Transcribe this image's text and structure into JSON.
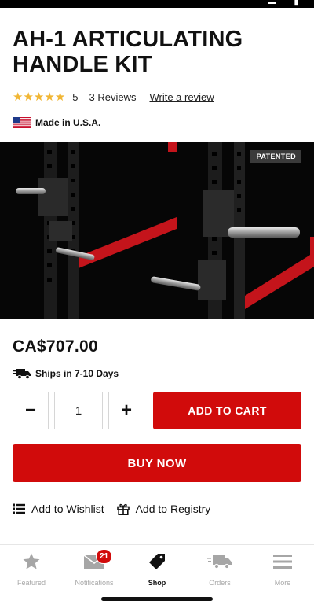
{
  "product": {
    "title": "AH-1 ARTICULATING HANDLE KIT",
    "rating_value": "5",
    "reviews_label": "3 Reviews",
    "write_review_label": "Write a review",
    "origin_label": "Made in U.S.A.",
    "badge_label": "PATENTED",
    "price": "CA$707.00",
    "shipping_label": "Ships in 7-10 Days",
    "quantity": "1",
    "minus_label": "−",
    "plus_label": "+",
    "add_to_cart_label": "ADD TO CART",
    "buy_now_label": "BUY NOW",
    "wishlist_label": "Add to Wishlist",
    "registry_label": "Add to Registry",
    "stars": 5
  },
  "colors": {
    "brand_red": "#d10b0b",
    "star": "#f1b634"
  },
  "tabbar": {
    "items": [
      {
        "label": "Featured",
        "icon": "star-icon"
      },
      {
        "label": "Notifications",
        "icon": "mail-icon",
        "badge": "21"
      },
      {
        "label": "Shop",
        "icon": "tag-icon",
        "active": true
      },
      {
        "label": "Orders",
        "icon": "truck-icon"
      },
      {
        "label": "More",
        "icon": "menu-icon"
      }
    ]
  }
}
